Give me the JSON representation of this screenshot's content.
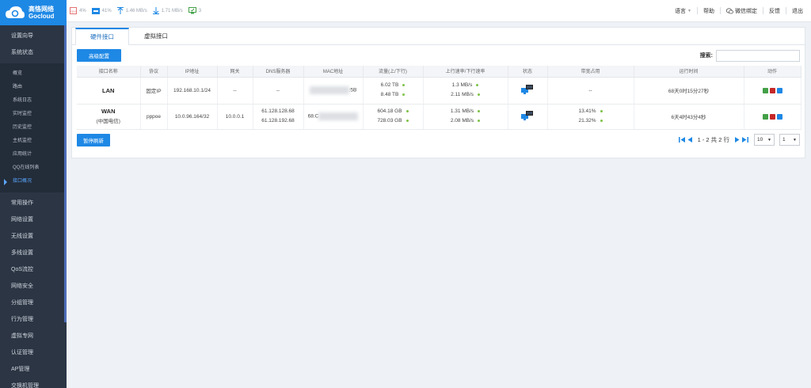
{
  "brand": {
    "name_cn": "高恪网络",
    "name_en": "Gocloud"
  },
  "topbar": {
    "stats": [
      {
        "icon": "cpu-icon",
        "value": "4%"
      },
      {
        "icon": "memory-icon",
        "value": "41%"
      },
      {
        "icon": "upload-arrow-icon",
        "value": "1.46 MB/s"
      },
      {
        "icon": "download-arrow-icon",
        "value": "1.71 MB/s"
      },
      {
        "icon": "online-devices-icon",
        "value": "3"
      }
    ],
    "links": {
      "language": "语言",
      "help": "帮助",
      "wechat": "微信绑定",
      "feedback": "反馈",
      "logout": "退出"
    }
  },
  "sidebar": {
    "top_items": [
      "设置向导",
      "系统状态"
    ],
    "sub_items": [
      "概览",
      "路由",
      "系统日志",
      "实时监控",
      "历史监控",
      "主机监控",
      "应用统计",
      "QQ在线列表",
      "接口概况"
    ],
    "active_sub": "接口概况",
    "bottom_items": [
      "常用操作",
      "网络设置",
      "无线设置",
      "多线设置",
      "QoS流控",
      "网络安全",
      "分组管理",
      "行为管理",
      "虚拟专网",
      "认证管理",
      "AP管理",
      "交换机管理"
    ]
  },
  "tabs": [
    "硬件接口",
    "虚拟接口"
  ],
  "toolbar": {
    "advanced_button": "高级配置",
    "search_label": "搜索:",
    "search_value": ""
  },
  "table": {
    "headers": [
      "接口名称",
      "协议",
      "IP地址",
      "网关",
      "DNS服务器",
      "MAC地址",
      "流量(上/下行)",
      "上行速率/下行速率",
      "状态",
      "带宽占用",
      "运行时间",
      "动作"
    ],
    "rows": [
      {
        "name": "LAN",
        "name2": "",
        "protocol": "固定IP",
        "ip": "192.168.10.1/24",
        "gateway": "--",
        "dns1": "--",
        "dns2": "",
        "mac_suffix": ":5B",
        "traffic_up": "6.02 TB",
        "traffic_down": "8.48 TB",
        "rate_up": "1.3 MB/s",
        "rate_down": "2.11 MB/s",
        "bw1": "--",
        "bw2": "",
        "uptime": "68天0时15分27秒"
      },
      {
        "name": "WAN",
        "name2": "(中国电信)",
        "protocol": "pppoe",
        "ip": "10.0.96.164/32",
        "gateway": "10.0.0.1",
        "dns1": "61.128.128.68",
        "dns2": "61.128.192.68",
        "mac_prefix": "68:C",
        "traffic_up": "604.18 GB",
        "traffic_down": "728.03 GB",
        "rate_up": "1.31 MB/s",
        "rate_down": "2.08 MB/s",
        "bw1": "13.41%",
        "bw2": "21.32%",
        "uptime": "6天4时43分4秒"
      }
    ]
  },
  "bottom": {
    "pause_button": "暂停刷新",
    "page_info": "1 - 2 共 2 行",
    "page_size": "10",
    "page_number": "1"
  },
  "colors": {
    "primary": "#1e88e5",
    "sidebar_bg": "#2b3544",
    "dot_green": "#7dc247"
  }
}
